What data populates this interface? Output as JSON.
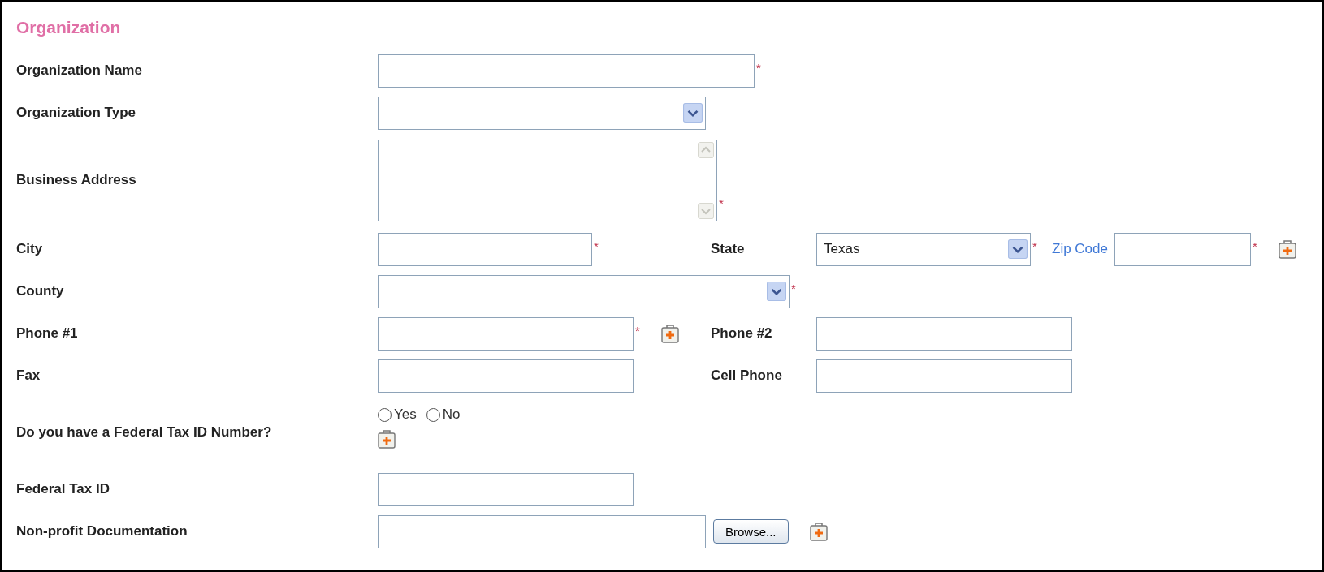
{
  "section_title": "Organization",
  "rows": [
    {
      "label": "Organization Name",
      "items": [
        {
          "kind": "text"
        },
        {
          "kind": "required",
          "text": "*"
        }
      ]
    },
    {
      "label": "Organization Type",
      "items": [
        {
          "kind": "select",
          "value": ""
        }
      ]
    },
    {
      "label": "Business Address",
      "items": [
        {
          "kind": "textarea"
        },
        {
          "kind": "required",
          "text": "*"
        }
      ]
    },
    {
      "label": "City",
      "items": [
        {
          "kind": "text"
        },
        {
          "kind": "required",
          "text": "*"
        },
        {
          "kind": "label",
          "text": "State"
        },
        {
          "kind": "select",
          "value": "Texas"
        },
        {
          "kind": "required",
          "text": "*"
        },
        {
          "kind": "link",
          "text": "Zip Code"
        },
        {
          "kind": "text"
        },
        {
          "kind": "required",
          "text": "*"
        },
        {
          "kind": "add"
        }
      ]
    },
    {
      "label": "County",
      "items": [
        {
          "kind": "select",
          "value": ""
        },
        {
          "kind": "required",
          "text": "*"
        }
      ]
    },
    {
      "label": "Phone #1",
      "items": [
        {
          "kind": "text"
        },
        {
          "kind": "required",
          "text": "*"
        },
        {
          "kind": "add"
        },
        {
          "kind": "label",
          "text": "Phone #2"
        },
        {
          "kind": "text"
        }
      ]
    },
    {
      "label": "Fax",
      "items": [
        {
          "kind": "text"
        },
        {
          "kind": "label",
          "text": "Cell Phone"
        },
        {
          "kind": "text"
        }
      ]
    },
    {
      "label": "Do you have a Federal Tax ID Number?",
      "items": [
        {
          "kind": "radios",
          "options": [
            {
              "label": "Yes",
              "selected": false
            },
            {
              "label": "No",
              "selected": false
            }
          ]
        }
      ]
    },
    {
      "label": "Federal Tax ID",
      "items": [
        {
          "kind": "text"
        }
      ]
    },
    {
      "label": "Non-profit Documentation",
      "items": [
        {
          "kind": "file",
          "button": "Browse..."
        },
        {
          "kind": "add"
        }
      ]
    }
  ]
}
